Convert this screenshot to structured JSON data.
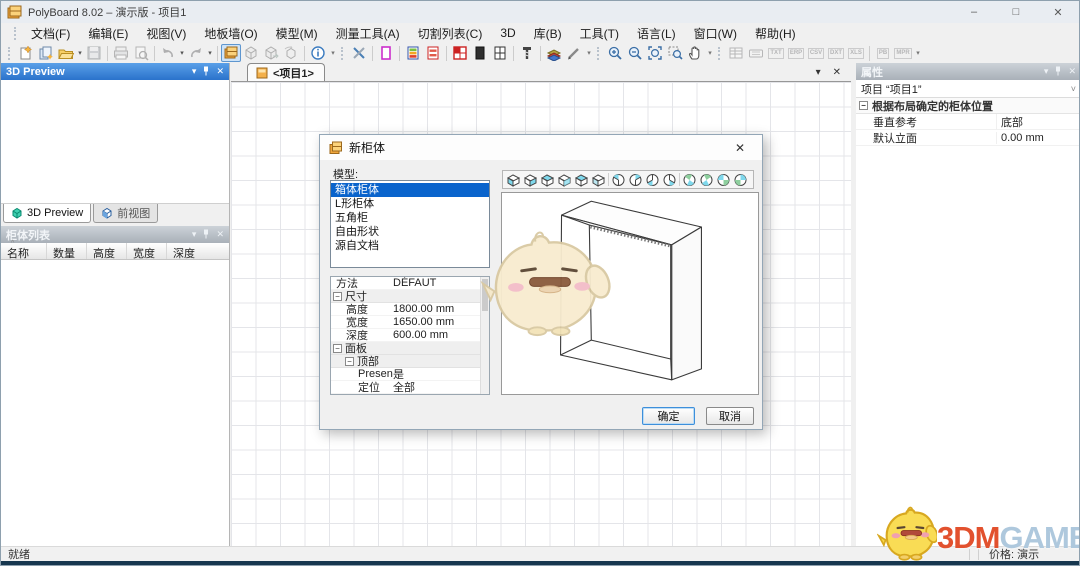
{
  "window": {
    "title": "PolyBoard 8.02 – 演示版 - 项目1",
    "minimize": "–",
    "maximize": "□",
    "close": "✕"
  },
  "menu": {
    "items": [
      "文档(F)",
      "编辑(E)",
      "视图(V)",
      "地板墙(O)",
      "模型(M)",
      "测量工具(A)",
      "切割列表(C)",
      "3D",
      "库(B)",
      "工具(T)",
      "语言(L)",
      "窗口(W)",
      "帮助(H)"
    ]
  },
  "toolbar": {
    "export_labels": [
      "TXT",
      "ERP",
      "CSV",
      "DXT",
      "XLS",
      "PB",
      "MPR"
    ]
  },
  "icons": {
    "chevron_down": "▾",
    "close": "✕",
    "select_chevron": "˅",
    "sort_caret": "^",
    "collapse": "−",
    "overflow": "▾"
  },
  "left_panel": {
    "preview_title": "3D Preview",
    "tabs": [
      {
        "label": "3D Preview"
      },
      {
        "label": "前视图"
      }
    ],
    "list_title": "柜体列表",
    "columns": [
      "名称",
      "数量",
      "高度",
      "宽度",
      "深度"
    ]
  },
  "canvas": {
    "tab_label": "<项目1>"
  },
  "properties": {
    "title": "属性",
    "selector": "项目 “项目1”",
    "group": "根据布局确定的柜体位置",
    "rows": [
      {
        "name": "垂直参考",
        "value": "底部"
      },
      {
        "name": "默认立面",
        "value": "0.00 mm"
      }
    ]
  },
  "dialog": {
    "title": "新柜体",
    "model_label": "模型:",
    "models": [
      "箱体柜体",
      "L形柜体",
      "五角柜",
      "自由形状",
      "源自文档"
    ],
    "selected_model": "箱体柜体",
    "grid_rows": [
      {
        "label": "方法",
        "value": "DÉFAUT"
      },
      {
        "label": "尺寸",
        "value": ""
      },
      {
        "label": "高度",
        "value": "1800.00 mm"
      },
      {
        "label": "宽度",
        "value": "1650.00 mm"
      },
      {
        "label": "深度",
        "value": "600.00 mm"
      },
      {
        "label": "面板",
        "value": ""
      },
      {
        "label": "顶部",
        "value": ""
      },
      {
        "label": "Present",
        "value": "是"
      },
      {
        "label": "定位",
        "value": "全部"
      }
    ],
    "ok": "确定",
    "cancel": "取消"
  },
  "statusbar": {
    "ready": "就绪",
    "price": "价格: 演示"
  },
  "watermark": {
    "brand_orange": "3DM",
    "brand_blue": "GAME"
  },
  "colors": {
    "selection_blue": "#0a64cc",
    "panel_active_blue": "#2a72cb",
    "brand_orange": "#e2512e",
    "brand_blue": "#aec8dd"
  }
}
